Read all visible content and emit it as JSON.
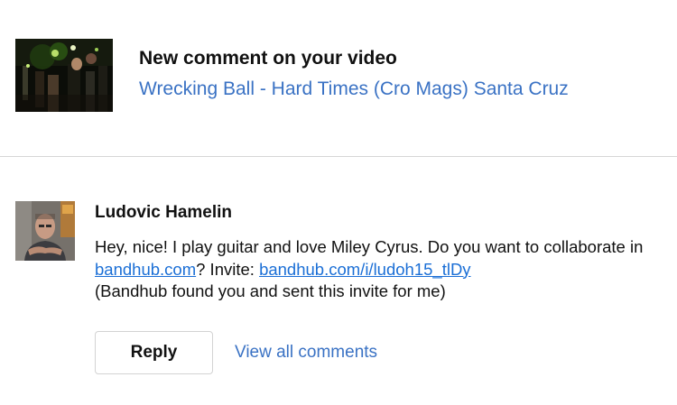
{
  "notification": {
    "thumbnail_icon": "video-thumbnail",
    "title": "New comment on your video",
    "video_link_text": "Wrecking Ball - Hard Times (Cro Mags) Santa Cruz"
  },
  "comment": {
    "avatar_icon": "user-avatar",
    "author": "Ludovic Hamelin",
    "text_part1": "Hey, nice! I play guitar and love Miley Cyrus. Do you want to collaborate in ",
    "link1": "bandhub.com",
    "text_part2": "? Invite: ",
    "link2": "bandhub.com/i/ludoh15_tlDy",
    "text_part3": "(Bandhub found you and sent this invite for me)"
  },
  "actions": {
    "reply_label": "Reply",
    "view_all_label": "View all comments"
  },
  "colors": {
    "link_blue": "#3a72c4",
    "inline_link_blue": "#1b6fd6",
    "divider": "#d6d6d6",
    "button_border": "#d3d3d3"
  }
}
